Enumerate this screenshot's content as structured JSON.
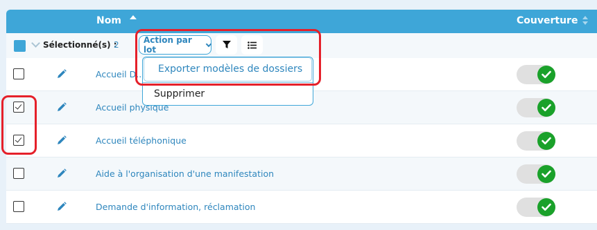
{
  "header": {
    "nom": "Nom",
    "couverture": "Couverture"
  },
  "toolbar": {
    "selected_label": "Sélectionné(s) :",
    "selected_count": "2",
    "batch_action": "Action par lot",
    "filter_icon": "filter-icon",
    "list_icon": "list-icon"
  },
  "dropdown": {
    "items": [
      "Exporter modèles de dossiers",
      "Supprimer"
    ]
  },
  "rows": [
    {
      "label": "Accueil D...",
      "checked": false,
      "coverage": true
    },
    {
      "label": "Accueil physique",
      "checked": true,
      "coverage": true
    },
    {
      "label": "Accueil téléphonique",
      "checked": true,
      "coverage": true
    },
    {
      "label": "Aide à l'organisation d'une manifestation",
      "checked": false,
      "coverage": true
    },
    {
      "label": "Demande d'information, réclamation",
      "checked": false,
      "coverage": true
    }
  ],
  "colors": {
    "accent": "#3ea6d8",
    "link": "#2e86bd",
    "toggle_on": "#1aa12a",
    "highlight": "#e5202a"
  }
}
